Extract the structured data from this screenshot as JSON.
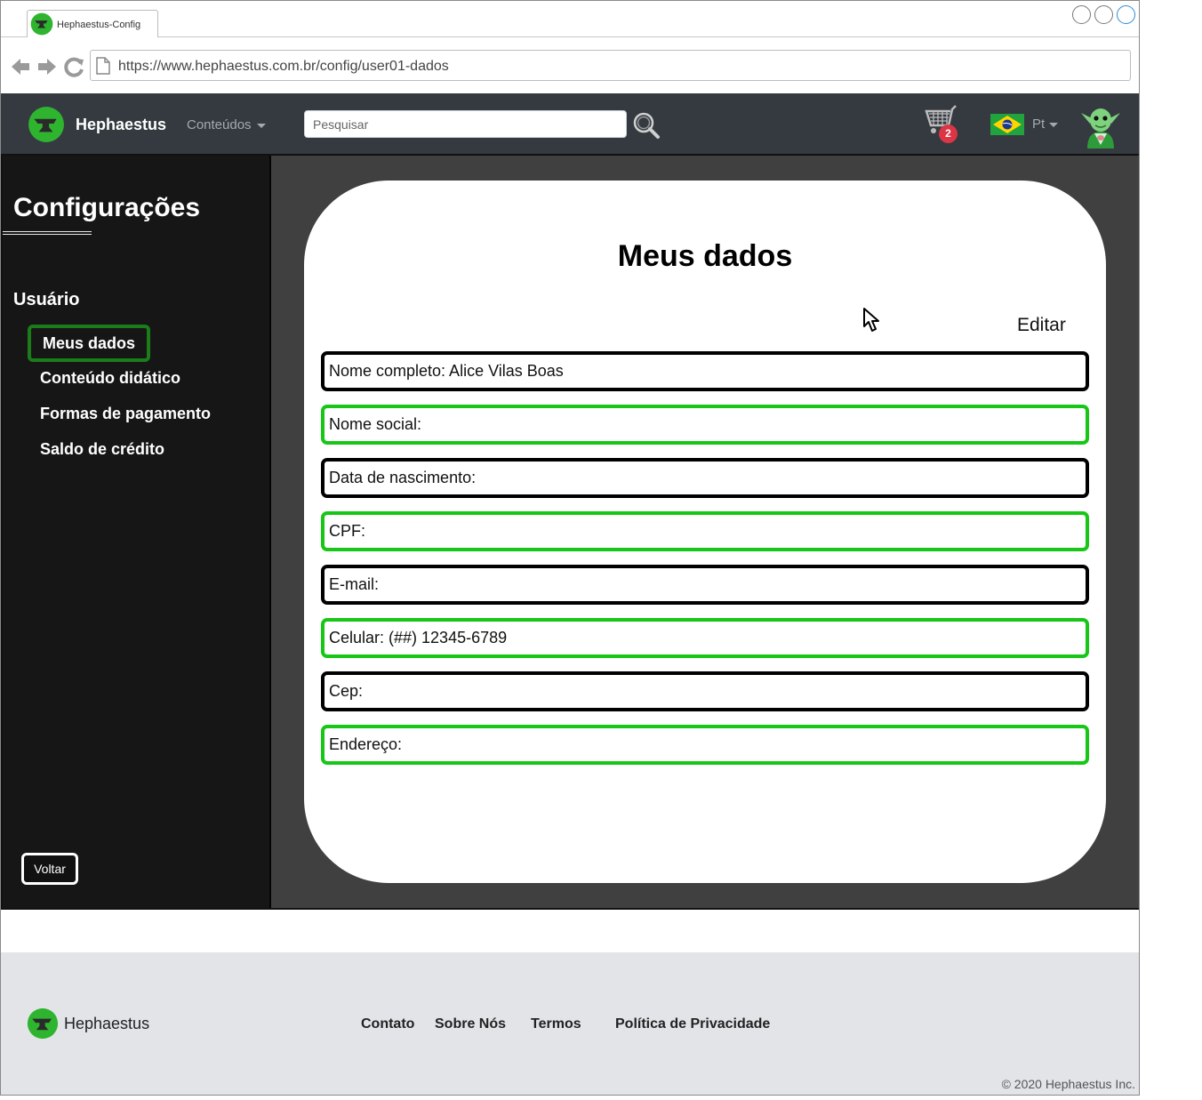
{
  "browser": {
    "tab_title": "Hephaestus-Config",
    "url": "https://www.hephaestus.com.br/config/user01-dados"
  },
  "navbar": {
    "brand": "Hephaestus",
    "menu_label": "Conteúdos",
    "search_placeholder": "Pesquisar",
    "cart_count": "2",
    "language": "Pt"
  },
  "sidebar": {
    "title": "Configurações",
    "section": "Usuário",
    "items": [
      {
        "label": "Meus dados",
        "active": true
      },
      {
        "label": "Conteúdo didático",
        "active": false
      },
      {
        "label": "Formas de pagamento",
        "active": false
      },
      {
        "label": "Saldo de crédito",
        "active": false
      }
    ],
    "back_label": "Voltar"
  },
  "content": {
    "title": "Meus dados",
    "edit_label": "Editar",
    "fields": [
      {
        "text": "Nome completo: Alice Vilas Boas",
        "border": "#000000"
      },
      {
        "text": "Nome social:",
        "border": "#17c617"
      },
      {
        "text": "Data de nascimento:",
        "border": "#000000"
      },
      {
        "text": "CPF:",
        "border": "#17c617"
      },
      {
        "text": "E-mail:",
        "border": "#000000"
      },
      {
        "text": "Celular: (##) 12345-6789",
        "border": "#17c617"
      },
      {
        "text": "Cep:",
        "border": "#000000"
      },
      {
        "text": "Endereço:",
        "border": "#17c617"
      }
    ]
  },
  "footer": {
    "brand": "Hephaestus",
    "links": [
      "Contato",
      "Sobre Nós",
      "Termos",
      "Política de Privacidade"
    ],
    "copyright": "© 2020 Hephaestus Inc."
  },
  "colors": {
    "navbar_bg": "#343a40",
    "sidebar_bg": "#161616",
    "main_bg": "#404040",
    "accent_green": "#17c617",
    "active_item_border": "#1a7d1a",
    "badge_red": "#dc3545"
  },
  "icons": [
    "anvil-logo-icon",
    "back-arrow-icon",
    "forward-arrow-icon",
    "reload-icon",
    "page-icon",
    "search-icon",
    "cart-icon",
    "brazil-flag-icon",
    "goblin-avatar-icon",
    "mouse-cursor-icon"
  ]
}
